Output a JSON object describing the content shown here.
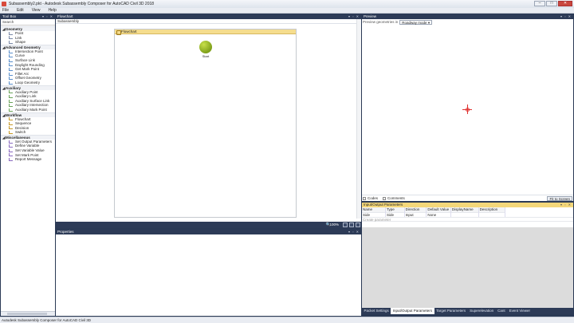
{
  "window": {
    "title": "Subassembly2.pkt - Autodesk Subassembly Composer for AutoCAD Civil 3D 2018"
  },
  "menu": [
    "File",
    "Edit",
    "View",
    "Help"
  ],
  "toolbox": {
    "title": "Tool Box",
    "search": "Search",
    "categories": [
      {
        "name": "Geometry",
        "items": [
          "Point",
          "Link",
          "Shape"
        ]
      },
      {
        "name": "Advanced Geometry",
        "items": [
          "Intersection Point",
          "Curve",
          "Surface Link",
          "Daylight Rounding",
          "Get Mark Point",
          "Fillet Arc",
          "Offset Geometry",
          "Loop Geometry"
        ]
      },
      {
        "name": "Auxiliary",
        "items": [
          "Auxiliary Point",
          "Auxiliary Link",
          "Auxiliary Surface Link",
          "Auxiliary Intersection",
          "Auxiliary Mark Point"
        ]
      },
      {
        "name": "Workflow",
        "items": [
          "Flowchart",
          "Sequence",
          "Decision",
          "Switch"
        ]
      },
      {
        "name": "Miscellaneous",
        "items": [
          "Set Output Parameters",
          "Define Variable",
          "Set Variable Value",
          "Set Mark Point",
          "Report Message"
        ]
      }
    ]
  },
  "flowchart": {
    "title": "Flowchart",
    "breadcrumb": "Subassembly",
    "canvas_header": "Flowchart",
    "start_label": "Start",
    "zoom": "100%"
  },
  "properties": {
    "title": "Properties"
  },
  "preview": {
    "title": "Preview",
    "geometry_label": "Preview geometries in",
    "mode": "Roadway mode",
    "codes": "Codes",
    "comments": "Comments",
    "fit": "Fit to Screen"
  },
  "io": {
    "title": "Input/Output Parameters",
    "columns": [
      "Name",
      "Type",
      "Direction",
      "Default Value",
      "DisplayName",
      "Description"
    ],
    "rows": [
      [
        "Side",
        "Side",
        "Input",
        "None",
        "",
        ""
      ]
    ],
    "new_param": "Create parameter"
  },
  "tabs": [
    "Packet Settings",
    "Input/Output Parameters",
    "Target Parameters",
    "Superelevation",
    "Cant",
    "Event Viewer"
  ],
  "status": "Autodesk Subassembly Composer for AutoCAD Civil 3D",
  "colors": {
    "panel_header": "#2d3b57",
    "flowchart_header": "#f5dd8e",
    "start_node": "#9cbf22",
    "crosshair": "#e0312f"
  }
}
